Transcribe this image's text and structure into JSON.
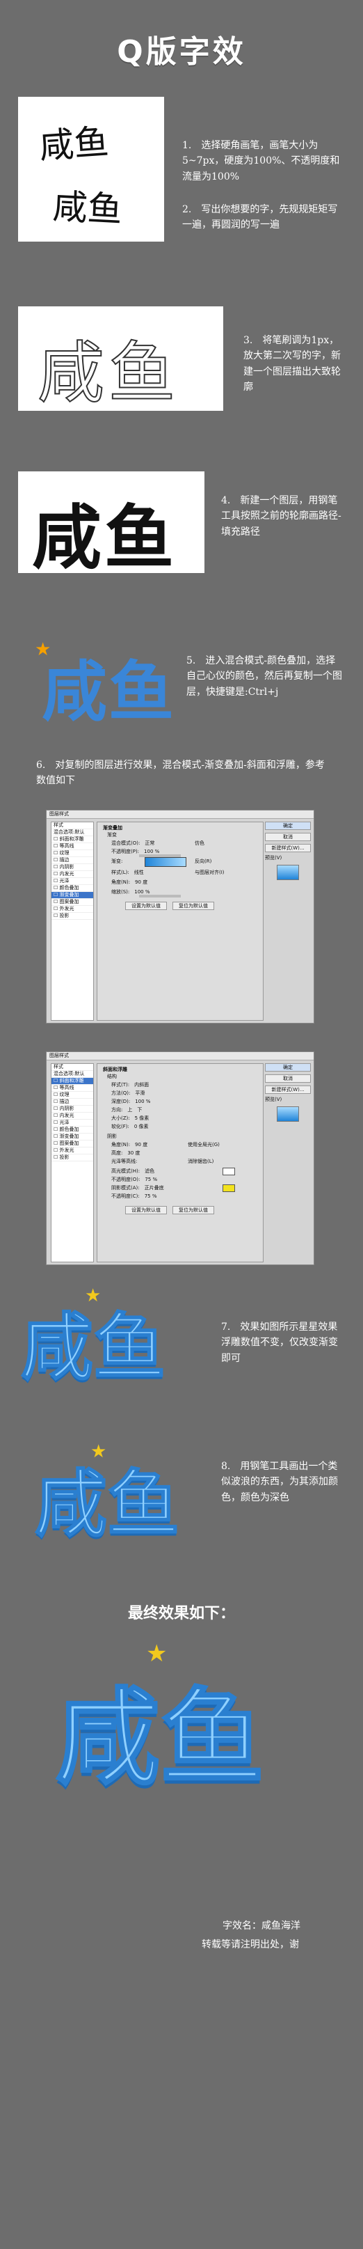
{
  "title": "Q版字效",
  "hand_text_1": "咸鱼",
  "hand_text_2": "咸鱼",
  "art_text": "咸鱼",
  "steps": {
    "s1": "1.　选择硬角画笔，画笔大小为5~7px，硬度为100%、不透明度和流量为100%",
    "s2": "2.　写出你想要的字，先规规矩矩写一遍，再圆润的写一遍",
    "s3": "3.　将笔刷调为1px，放大第二次写的字，新建一个图层描出大致轮廓",
    "s4": "4.　新建一个图层，用钢笔工具按照之前的轮廓画路径-填充路径",
    "s5": "5.　进入混合模式-颜色叠加，选择自己心仪的颜色，然后再复制一个图层，快捷键是:Ctrl+j",
    "s6": "6.　对复制的图层进行效果，混合模式-渐变叠加-斜面和浮雕，参考数值如下",
    "s7": "7.　效果如图所示星星效果浮雕数值不变，仅改变渐变即可",
    "s8": "8.　用钢笔工具画出一个类似波浪的东西，为其添加颜色，颜色为深色"
  },
  "final_heading": "最终效果如下：",
  "credit_1": "字效名：咸鱼海洋",
  "credit_2": "转载等请注明出处，谢",
  "ps1": {
    "title": "图层样式",
    "sidebar": [
      "样式",
      "混合选项:默认",
      "斜面和浮雕",
      "等高线",
      "纹理",
      "描边",
      "内阴影",
      "内发光",
      "光泽",
      "颜色叠加",
      "渐变叠加",
      "图案叠加",
      "外发光",
      "投影"
    ],
    "selected_index": 10,
    "section": "渐变叠加",
    "sub": "渐变",
    "rows": [
      "混合模式(O):　正常",
      "不透明度(P):　100 %",
      "渐变:",
      "样式(L):　线性",
      "角度(N):　90 度",
      "缩放(S):　100 %"
    ],
    "checkboxes": [
      "仿色",
      "反向(R)",
      "与图层对齐(I)"
    ],
    "foot_buttons": [
      "设置为默认值",
      "复位为默认值"
    ],
    "buttons": [
      "确定",
      "取消",
      "新建样式(W)...",
      "预览(V)"
    ]
  },
  "ps2": {
    "title": "图层样式",
    "sidebar": [
      "样式",
      "混合选项:默认",
      "斜面和浮雕",
      "等高线",
      "纹理",
      "描边",
      "内阴影",
      "内发光",
      "光泽",
      "颜色叠加",
      "渐变叠加",
      "图案叠加",
      "外发光",
      "投影"
    ],
    "selected_index": 2,
    "section": "斜面和浮雕",
    "sub": "结构",
    "rows": [
      "样式(T):　内斜面",
      "方法(Q):　平滑",
      "深度(D):　100 %",
      "方向:　上　下",
      "大小(Z):　5 像素",
      "软化(F):　0 像素"
    ],
    "shade": "阴影",
    "shade_rows": [
      "角度(N):　90 度",
      "高度:　30 度",
      "光泽等高线:",
      "高光模式(H):　滤色",
      "不透明度(O):　75 %",
      "阴影模式(A):　正片叠底",
      "不透明度(C):　75 %"
    ],
    "shade_checks": [
      "使用全局光(G)",
      "消除锯齿(L)"
    ],
    "foot_buttons": [
      "设置为默认值",
      "复位为默认值"
    ],
    "buttons": [
      "确定",
      "取消",
      "新建样式(W)...",
      "预览(V)"
    ]
  },
  "colors": {
    "bg": "#6d6d6d",
    "blue_top": "#a9dcff",
    "blue_bottom": "#1f84d8",
    "star": "#f2c91e"
  }
}
